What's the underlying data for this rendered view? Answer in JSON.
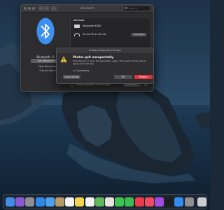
{
  "bluetooth_window": {
    "title": "Bluetooth",
    "search_placeholder": "Search",
    "status_text": "Bluetooth: O",
    "toggle_button": "Turn Bluetooth",
    "subtext_1": "Now discoverab",
    "subtext_2": "\"Chris's Mac m",
    "devices_header": "Devices",
    "devices": [
      {
        "name": "Keyboard K380",
        "icon": "keyboard-icon",
        "action": ""
      },
      {
        "name": "54-44-79-11-89-ed",
        "icon": "headphones-icon",
        "action": "Connect"
      }
    ],
    "show_in_menu_bar_label": "Show Bluetooth in menu bar",
    "advanced_button": "Advanced...",
    "help_button": "?"
  },
  "problem_dialog": {
    "title": "Problem Report for Photos",
    "heading": "Photos quit unexpectedly.",
    "message": "Click Reopen to open the application again. This report will be sent to Apple automatically.",
    "comments_label": "Comments",
    "show_details_button": "Show Details",
    "ok_button": "OK",
    "reopen_button": "Reopen"
  },
  "dock": {
    "apps": [
      {
        "name": "finder-icon",
        "color": "#3e8ee6"
      },
      {
        "name": "siri-icon",
        "color": "#8a58d6"
      },
      {
        "name": "launchpad-icon",
        "color": "#8e8e93"
      },
      {
        "name": "safari-icon",
        "color": "#2d8ae6"
      },
      {
        "name": "mail-icon",
        "color": "#4ea1f0"
      },
      {
        "name": "contacts-icon",
        "color": "#b89a6a"
      },
      {
        "name": "calendar-icon",
        "color": "#f4f4f4"
      },
      {
        "name": "notes-icon",
        "color": "#f2d54a"
      },
      {
        "name": "reminders-icon",
        "color": "#f4f4f4"
      },
      {
        "name": "maps-icon",
        "color": "#5fb85a"
      },
      {
        "name": "photos-icon",
        "color": "#e8e4e0"
      },
      {
        "name": "messages-icon",
        "color": "#3fc552"
      },
      {
        "name": "facetime-icon",
        "color": "#3bbf55"
      },
      {
        "name": "news-icon",
        "color": "#ee3b4b"
      },
      {
        "name": "music-icon",
        "color": "#f04b5f"
      },
      {
        "name": "podcasts-icon",
        "color": "#a54ce0"
      },
      {
        "name": "tv-icon",
        "color": "#1d1d1f"
      },
      {
        "name": "appstore-icon",
        "color": "#2f8cf0"
      },
      {
        "name": "system-preferences-icon",
        "color": "#8e8e93"
      },
      {
        "name": "trash-icon",
        "color": "#c7ccd3"
      }
    ]
  }
}
